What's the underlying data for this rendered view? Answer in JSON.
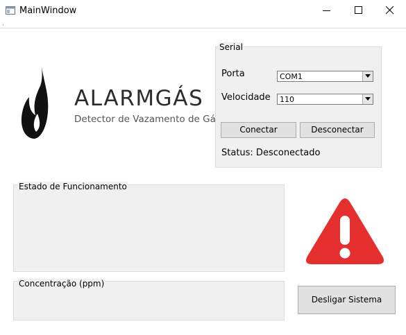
{
  "window": {
    "title": "MainWindow",
    "controls": {
      "minimize": "minimize",
      "maximize": "maximize",
      "close": "close"
    }
  },
  "brand": {
    "name": "ALARMGÁS",
    "subtitle": "Detector de Vazamento de Gás",
    "logo_icon": "flame-icon"
  },
  "serial": {
    "title": "Serial",
    "port_label": "Porta",
    "port_value": "COM1",
    "speed_label": "Velocidade",
    "speed_value": "110",
    "connect_label": "Conectar",
    "disconnect_label": "Desconectar",
    "status_text": "Status: Desconectado"
  },
  "estado": {
    "title": "Estado de Funcionamento"
  },
  "concentracao": {
    "title": "Concentração (ppm)"
  },
  "alert": {
    "icon": "warning-triangle-icon",
    "color": "#e52e2e"
  },
  "actions": {
    "shutdown_label": "Desligar Sistema"
  }
}
